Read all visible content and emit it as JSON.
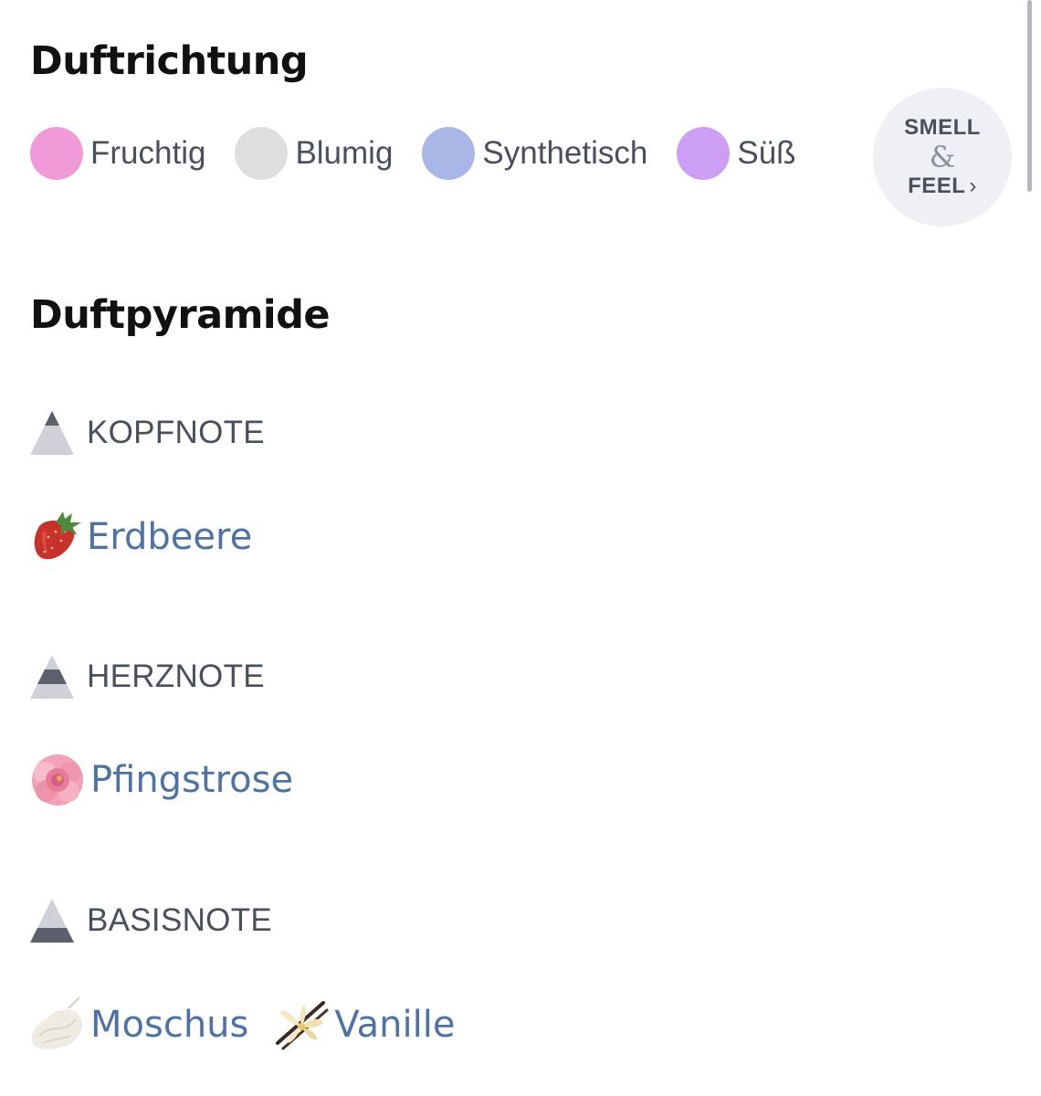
{
  "duftrichtung": {
    "title": "Duftrichtung",
    "tags": [
      {
        "label": "Fruchtig",
        "color": "#f09ad8"
      },
      {
        "label": "Blumig",
        "color": "#dedede"
      },
      {
        "label": "Synthetisch",
        "color": "#a9b7e6"
      },
      {
        "label": "Süß",
        "color": "#cc9ff5"
      }
    ],
    "smell_feel": {
      "line1": "SMELL",
      "amp": "&",
      "line2": "FEEL",
      "chevron": "›"
    }
  },
  "duftpyramide": {
    "title": "Duftpyramide",
    "kopfnote": {
      "label": "KOPFNOTE",
      "icon": "pyramid-top-icon",
      "ingredients": [
        {
          "label": "Erdbeere",
          "icon": "strawberry-icon"
        }
      ]
    },
    "herznote": {
      "label": "HERZNOTE",
      "icon": "pyramid-middle-icon",
      "ingredients": [
        {
          "label": "Pfingstrose",
          "icon": "peony-icon"
        }
      ]
    },
    "basisnote": {
      "label": "BASISNOTE",
      "icon": "pyramid-base-icon",
      "ingredients": [
        {
          "label": "Moschus",
          "icon": "musk-icon"
        },
        {
          "label": "Vanille",
          "icon": "vanilla-icon"
        }
      ]
    }
  }
}
